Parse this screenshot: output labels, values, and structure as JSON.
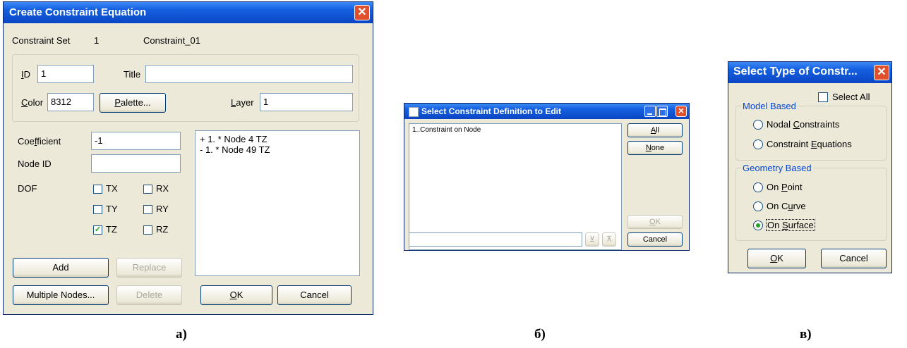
{
  "dialog_a": {
    "title": "Create Constraint Equation",
    "constraint_set_label": "Constraint Set",
    "constraint_set_id": "1",
    "constraint_set_name": "Constraint_01",
    "id_label": "ID",
    "id_value": "1",
    "title_label": "Title",
    "title_value": "",
    "color_label": "Color",
    "color_value": "8312",
    "palette_button": "Palette...",
    "layer_label": "Layer",
    "layer_value": "1",
    "coefficient_label": "Coefficient",
    "coefficient_value": "-1",
    "node_id_label": "Node ID",
    "node_id_value": "",
    "dof_label": "DOF",
    "dof": [
      {
        "label": "TX",
        "checked": false
      },
      {
        "label": "RX",
        "checked": false
      },
      {
        "label": "TY",
        "checked": false
      },
      {
        "label": "RY",
        "checked": false
      },
      {
        "label": "TZ",
        "checked": true
      },
      {
        "label": "RZ",
        "checked": false
      }
    ],
    "equation_terms": [
      "+ 1. * Node 4 TZ",
      "- 1. * Node 49 TZ"
    ],
    "add_button": "Add",
    "replace_button": "Replace",
    "multiple_nodes_button": "Multiple Nodes...",
    "delete_button": "Delete",
    "ok_button": "OK",
    "cancel_button": "Cancel"
  },
  "dialog_b": {
    "title": "Select Constraint Definition to Edit",
    "items": [
      "1..Constraint on Node"
    ],
    "all_button": "All",
    "none_button": "None",
    "ok_button": "OK",
    "cancel_button": "Cancel",
    "filter_value": ""
  },
  "dialog_c": {
    "title": "Select Type of Constr...",
    "select_all_label": "Select All",
    "model_based_label": "Model Based",
    "nodal_constraints": "Nodal Constraints",
    "constraint_equations": "Constraint Equations",
    "geometry_based_label": "Geometry Based",
    "on_point": "On Point",
    "on_curve": "On Curve",
    "on_surface": "On Surface",
    "selected_option": "On Surface",
    "ok_button": "OK",
    "cancel_button": "Cancel"
  },
  "captions": [
    "а)",
    "б)",
    "в)"
  ]
}
